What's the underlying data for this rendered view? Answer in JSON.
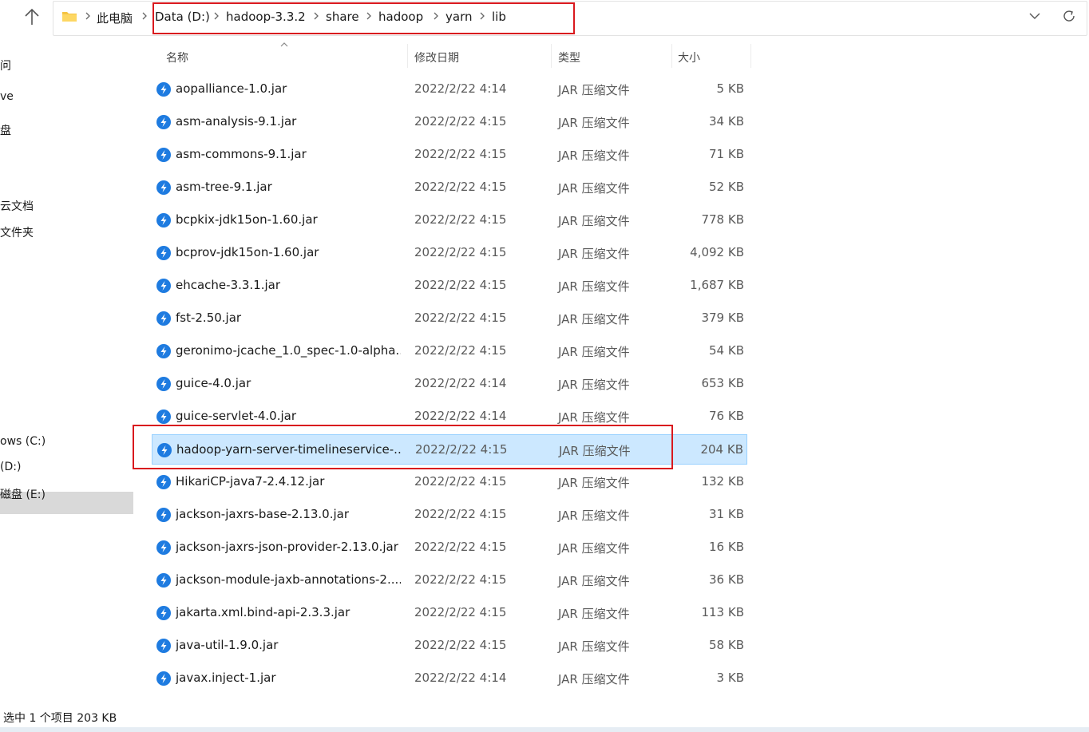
{
  "address_bar": {
    "root_label": "此电脑",
    "crumbs": [
      "Data (D:)",
      "hadoop-3.3.2",
      "share",
      "hadoop",
      "yarn",
      "lib"
    ],
    "highlight_color": "#d9191e"
  },
  "sidebar": {
    "items": [
      {
        "label": "问"
      },
      {
        "label": "ve"
      },
      {
        "label": "盘"
      },
      {
        "label": "云文档"
      },
      {
        "label": "文件夹"
      },
      {
        "label": "ows (C:)"
      },
      {
        "label": "(D:)",
        "selected": true
      },
      {
        "label": "磁盘 (E:)"
      }
    ]
  },
  "columns": {
    "name": "名称",
    "date": "修改日期",
    "type": "类型",
    "size": "大小"
  },
  "files": [
    {
      "name": "aopalliance-1.0.jar",
      "date": "2022/2/22 4:14",
      "type": "JAR 压缩文件",
      "size": "5 KB"
    },
    {
      "name": "asm-analysis-9.1.jar",
      "date": "2022/2/22 4:15",
      "type": "JAR 压缩文件",
      "size": "34 KB"
    },
    {
      "name": "asm-commons-9.1.jar",
      "date": "2022/2/22 4:15",
      "type": "JAR 压缩文件",
      "size": "71 KB"
    },
    {
      "name": "asm-tree-9.1.jar",
      "date": "2022/2/22 4:15",
      "type": "JAR 压缩文件",
      "size": "52 KB"
    },
    {
      "name": "bcpkix-jdk15on-1.60.jar",
      "date": "2022/2/22 4:15",
      "type": "JAR 压缩文件",
      "size": "778 KB"
    },
    {
      "name": "bcprov-jdk15on-1.60.jar",
      "date": "2022/2/22 4:15",
      "type": "JAR 压缩文件",
      "size": "4,092 KB"
    },
    {
      "name": "ehcache-3.3.1.jar",
      "date": "2022/2/22 4:15",
      "type": "JAR 压缩文件",
      "size": "1,687 KB"
    },
    {
      "name": "fst-2.50.jar",
      "date": "2022/2/22 4:15",
      "type": "JAR 压缩文件",
      "size": "379 KB"
    },
    {
      "name": "geronimo-jcache_1.0_spec-1.0-alpha...",
      "date": "2022/2/22 4:15",
      "type": "JAR 压缩文件",
      "size": "54 KB"
    },
    {
      "name": "guice-4.0.jar",
      "date": "2022/2/22 4:14",
      "type": "JAR 压缩文件",
      "size": "653 KB"
    },
    {
      "name": "guice-servlet-4.0.jar",
      "date": "2022/2/22 4:14",
      "type": "JAR 压缩文件",
      "size": "76 KB"
    },
    {
      "name": "hadoop-yarn-server-timelineservice-...",
      "date": "2022/2/22 4:15",
      "type": "JAR 压缩文件",
      "size": "204 KB",
      "selected": true
    },
    {
      "name": "HikariCP-java7-2.4.12.jar",
      "date": "2022/2/22 4:15",
      "type": "JAR 压缩文件",
      "size": "132 KB"
    },
    {
      "name": "jackson-jaxrs-base-2.13.0.jar",
      "date": "2022/2/22 4:15",
      "type": "JAR 压缩文件",
      "size": "31 KB"
    },
    {
      "name": "jackson-jaxrs-json-provider-2.13.0.jar",
      "date": "2022/2/22 4:15",
      "type": "JAR 压缩文件",
      "size": "16 KB"
    },
    {
      "name": "jackson-module-jaxb-annotations-2....",
      "date": "2022/2/22 4:15",
      "type": "JAR 压缩文件",
      "size": "36 KB"
    },
    {
      "name": "jakarta.xml.bind-api-2.3.3.jar",
      "date": "2022/2/22 4:15",
      "type": "JAR 压缩文件",
      "size": "113 KB"
    },
    {
      "name": "java-util-1.9.0.jar",
      "date": "2022/2/22 4:15",
      "type": "JAR 压缩文件",
      "size": "58 KB"
    },
    {
      "name": "javax.inject-1.jar",
      "date": "2022/2/22 4:14",
      "type": "JAR 压缩文件",
      "size": "3 KB"
    }
  ],
  "status_bar": {
    "text": "选中 1 个项目  203 KB"
  },
  "colors": {
    "selection_bg": "#cce8ff",
    "selection_border": "#99d1ff",
    "jar_icon": "#1e7be0",
    "annotation_red": "#d9191e"
  },
  "icons": {
    "up": "up-arrow-icon",
    "folder": "folder-icon",
    "separator": "chevron-right-icon",
    "dropdown": "chevron-down-icon",
    "refresh": "refresh-icon",
    "file": "jar-file-icon"
  }
}
